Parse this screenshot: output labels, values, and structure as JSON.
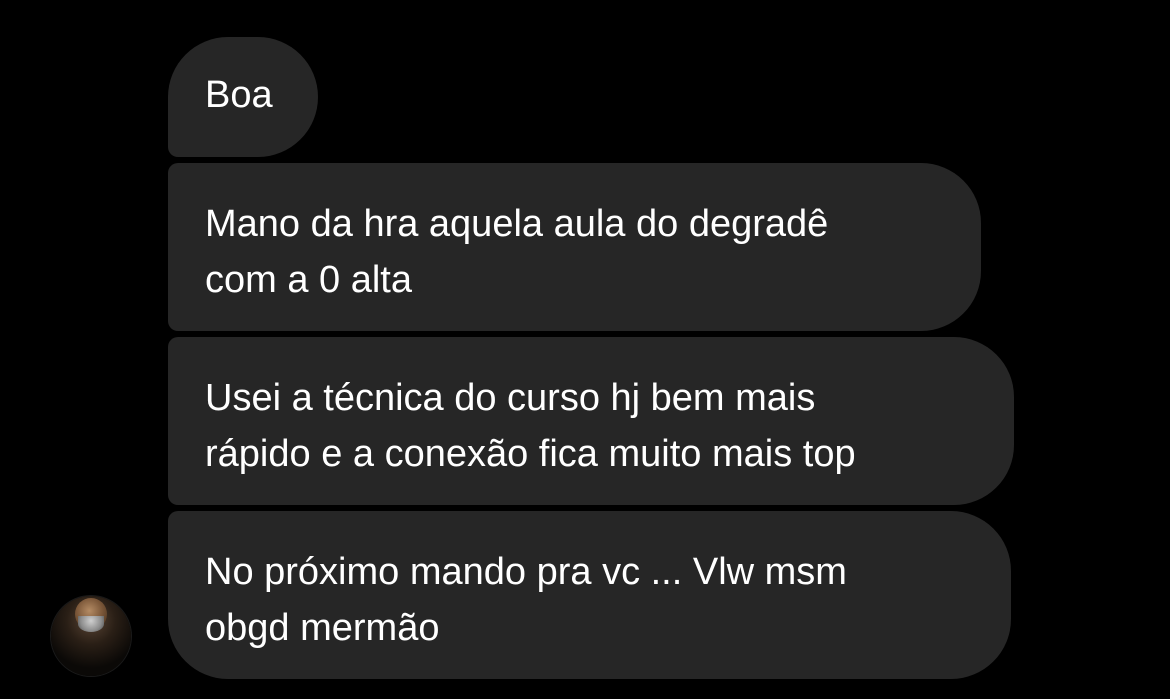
{
  "messages": [
    {
      "text": "Boa"
    },
    {
      "text": "Mano da hra aquela aula do degradê\ncom a 0 alta"
    },
    {
      "text": "Usei a técnica do curso hj bem mais\nrápido e a conexão fica muito mais top"
    },
    {
      "text": "No próximo mando pra vc ... Vlw msm\nobgd mermão"
    }
  ],
  "colors": {
    "background": "#000000",
    "bubble": "#262626",
    "text": "#ffffff"
  }
}
